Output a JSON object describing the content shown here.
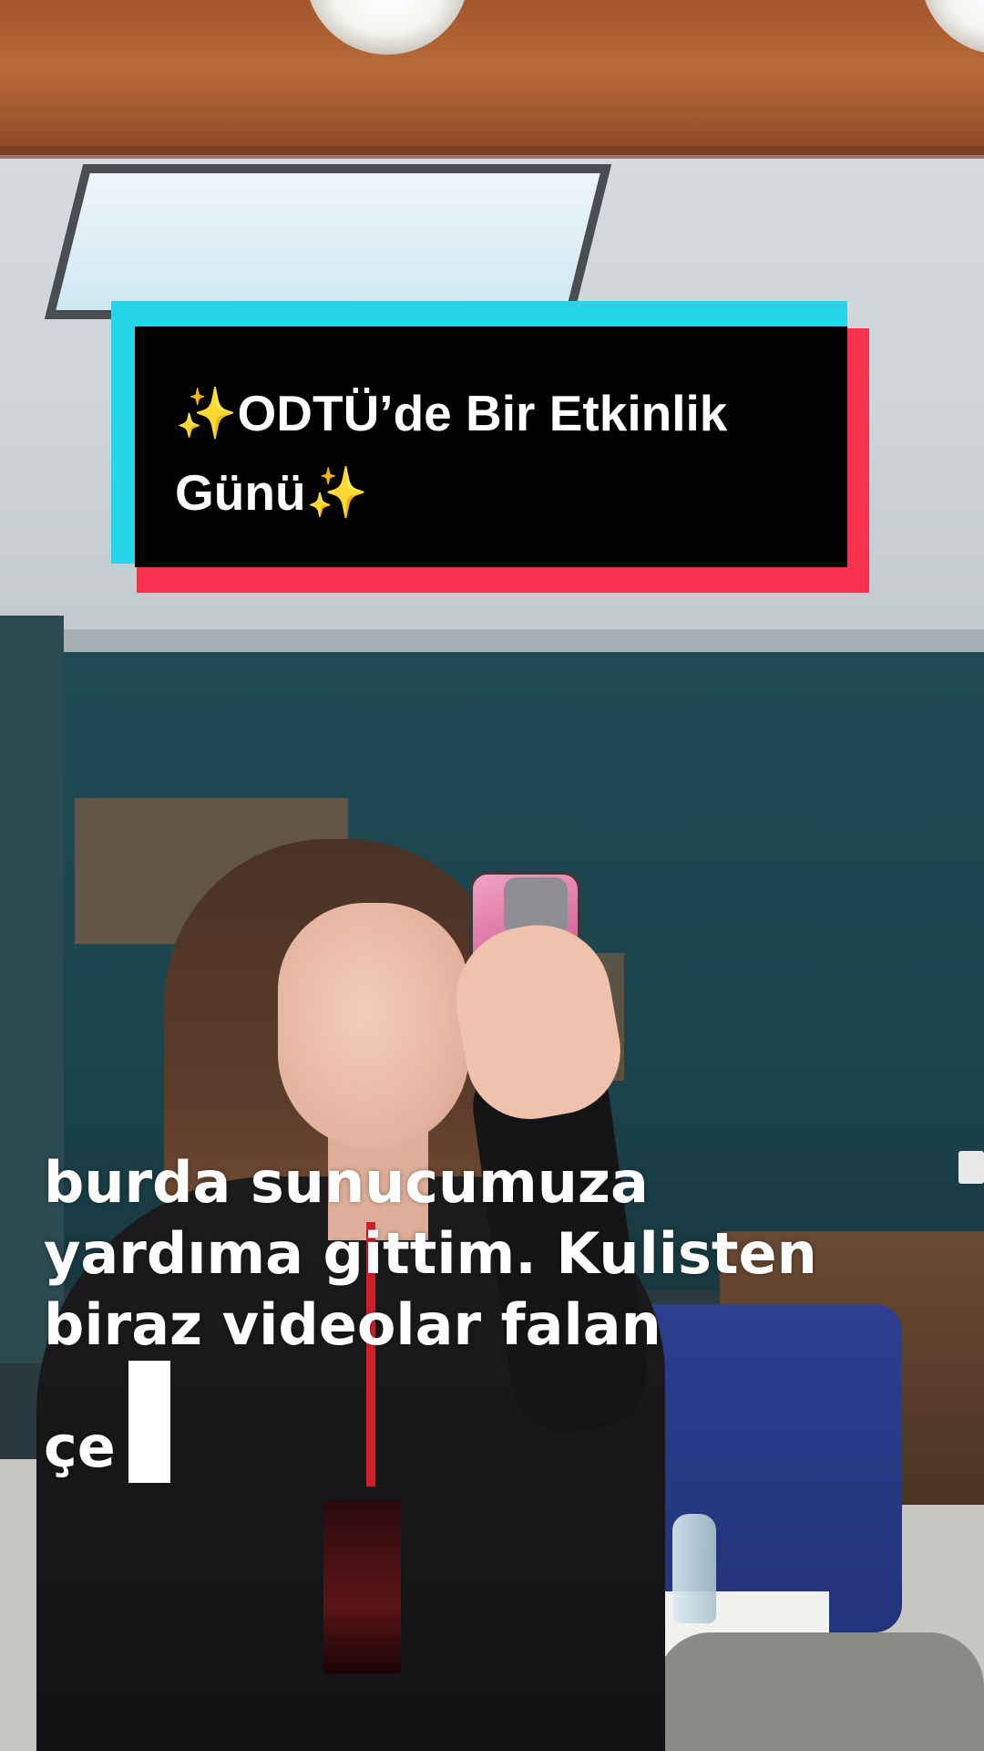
{
  "title_card": {
    "line1": "✨ODTÜ’de Bir Etkinlik",
    "line2": "Günü✨",
    "colors": {
      "cyan": "#25d6ea",
      "red": "#f8334f",
      "fill": "#000000",
      "text": "#ffffff"
    }
  },
  "caption": {
    "lines": [
      "burda sunucumuza",
      "yardıma gittim. Kulisten",
      "biraz videolar falan",
      "çe"
    ],
    "cursor_icon": "text-cursor-block"
  }
}
